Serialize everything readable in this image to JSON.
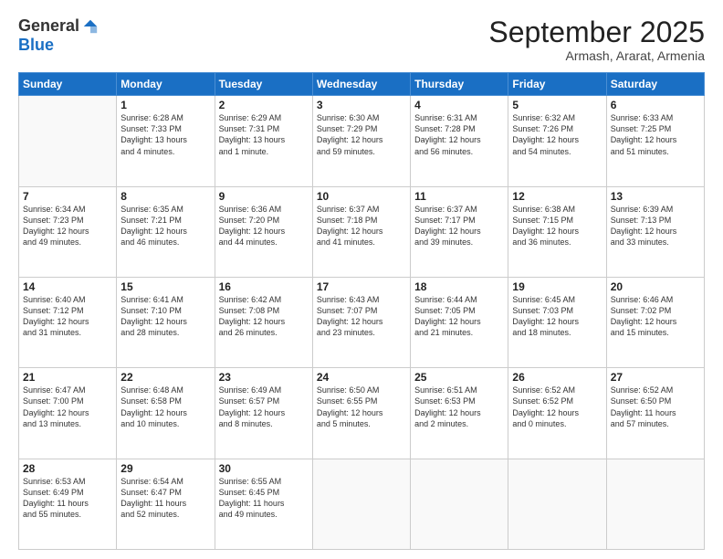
{
  "logo": {
    "general": "General",
    "blue": "Blue"
  },
  "header": {
    "month": "September 2025",
    "location": "Armash, Ararat, Armenia"
  },
  "weekdays": [
    "Sunday",
    "Monday",
    "Tuesday",
    "Wednesday",
    "Thursday",
    "Friday",
    "Saturday"
  ],
  "weeks": [
    [
      {
        "day": "",
        "info": ""
      },
      {
        "day": "1",
        "info": "Sunrise: 6:28 AM\nSunset: 7:33 PM\nDaylight: 13 hours\nand 4 minutes."
      },
      {
        "day": "2",
        "info": "Sunrise: 6:29 AM\nSunset: 7:31 PM\nDaylight: 13 hours\nand 1 minute."
      },
      {
        "day": "3",
        "info": "Sunrise: 6:30 AM\nSunset: 7:29 PM\nDaylight: 12 hours\nand 59 minutes."
      },
      {
        "day": "4",
        "info": "Sunrise: 6:31 AM\nSunset: 7:28 PM\nDaylight: 12 hours\nand 56 minutes."
      },
      {
        "day": "5",
        "info": "Sunrise: 6:32 AM\nSunset: 7:26 PM\nDaylight: 12 hours\nand 54 minutes."
      },
      {
        "day": "6",
        "info": "Sunrise: 6:33 AM\nSunset: 7:25 PM\nDaylight: 12 hours\nand 51 minutes."
      }
    ],
    [
      {
        "day": "7",
        "info": "Sunrise: 6:34 AM\nSunset: 7:23 PM\nDaylight: 12 hours\nand 49 minutes."
      },
      {
        "day": "8",
        "info": "Sunrise: 6:35 AM\nSunset: 7:21 PM\nDaylight: 12 hours\nand 46 minutes."
      },
      {
        "day": "9",
        "info": "Sunrise: 6:36 AM\nSunset: 7:20 PM\nDaylight: 12 hours\nand 44 minutes."
      },
      {
        "day": "10",
        "info": "Sunrise: 6:37 AM\nSunset: 7:18 PM\nDaylight: 12 hours\nand 41 minutes."
      },
      {
        "day": "11",
        "info": "Sunrise: 6:37 AM\nSunset: 7:17 PM\nDaylight: 12 hours\nand 39 minutes."
      },
      {
        "day": "12",
        "info": "Sunrise: 6:38 AM\nSunset: 7:15 PM\nDaylight: 12 hours\nand 36 minutes."
      },
      {
        "day": "13",
        "info": "Sunrise: 6:39 AM\nSunset: 7:13 PM\nDaylight: 12 hours\nand 33 minutes."
      }
    ],
    [
      {
        "day": "14",
        "info": "Sunrise: 6:40 AM\nSunset: 7:12 PM\nDaylight: 12 hours\nand 31 minutes."
      },
      {
        "day": "15",
        "info": "Sunrise: 6:41 AM\nSunset: 7:10 PM\nDaylight: 12 hours\nand 28 minutes."
      },
      {
        "day": "16",
        "info": "Sunrise: 6:42 AM\nSunset: 7:08 PM\nDaylight: 12 hours\nand 26 minutes."
      },
      {
        "day": "17",
        "info": "Sunrise: 6:43 AM\nSunset: 7:07 PM\nDaylight: 12 hours\nand 23 minutes."
      },
      {
        "day": "18",
        "info": "Sunrise: 6:44 AM\nSunset: 7:05 PM\nDaylight: 12 hours\nand 21 minutes."
      },
      {
        "day": "19",
        "info": "Sunrise: 6:45 AM\nSunset: 7:03 PM\nDaylight: 12 hours\nand 18 minutes."
      },
      {
        "day": "20",
        "info": "Sunrise: 6:46 AM\nSunset: 7:02 PM\nDaylight: 12 hours\nand 15 minutes."
      }
    ],
    [
      {
        "day": "21",
        "info": "Sunrise: 6:47 AM\nSunset: 7:00 PM\nDaylight: 12 hours\nand 13 minutes."
      },
      {
        "day": "22",
        "info": "Sunrise: 6:48 AM\nSunset: 6:58 PM\nDaylight: 12 hours\nand 10 minutes."
      },
      {
        "day": "23",
        "info": "Sunrise: 6:49 AM\nSunset: 6:57 PM\nDaylight: 12 hours\nand 8 minutes."
      },
      {
        "day": "24",
        "info": "Sunrise: 6:50 AM\nSunset: 6:55 PM\nDaylight: 12 hours\nand 5 minutes."
      },
      {
        "day": "25",
        "info": "Sunrise: 6:51 AM\nSunset: 6:53 PM\nDaylight: 12 hours\nand 2 minutes."
      },
      {
        "day": "26",
        "info": "Sunrise: 6:52 AM\nSunset: 6:52 PM\nDaylight: 12 hours\nand 0 minutes."
      },
      {
        "day": "27",
        "info": "Sunrise: 6:52 AM\nSunset: 6:50 PM\nDaylight: 11 hours\nand 57 minutes."
      }
    ],
    [
      {
        "day": "28",
        "info": "Sunrise: 6:53 AM\nSunset: 6:49 PM\nDaylight: 11 hours\nand 55 minutes."
      },
      {
        "day": "29",
        "info": "Sunrise: 6:54 AM\nSunset: 6:47 PM\nDaylight: 11 hours\nand 52 minutes."
      },
      {
        "day": "30",
        "info": "Sunrise: 6:55 AM\nSunset: 6:45 PM\nDaylight: 11 hours\nand 49 minutes."
      },
      {
        "day": "",
        "info": ""
      },
      {
        "day": "",
        "info": ""
      },
      {
        "day": "",
        "info": ""
      },
      {
        "day": "",
        "info": ""
      }
    ]
  ]
}
